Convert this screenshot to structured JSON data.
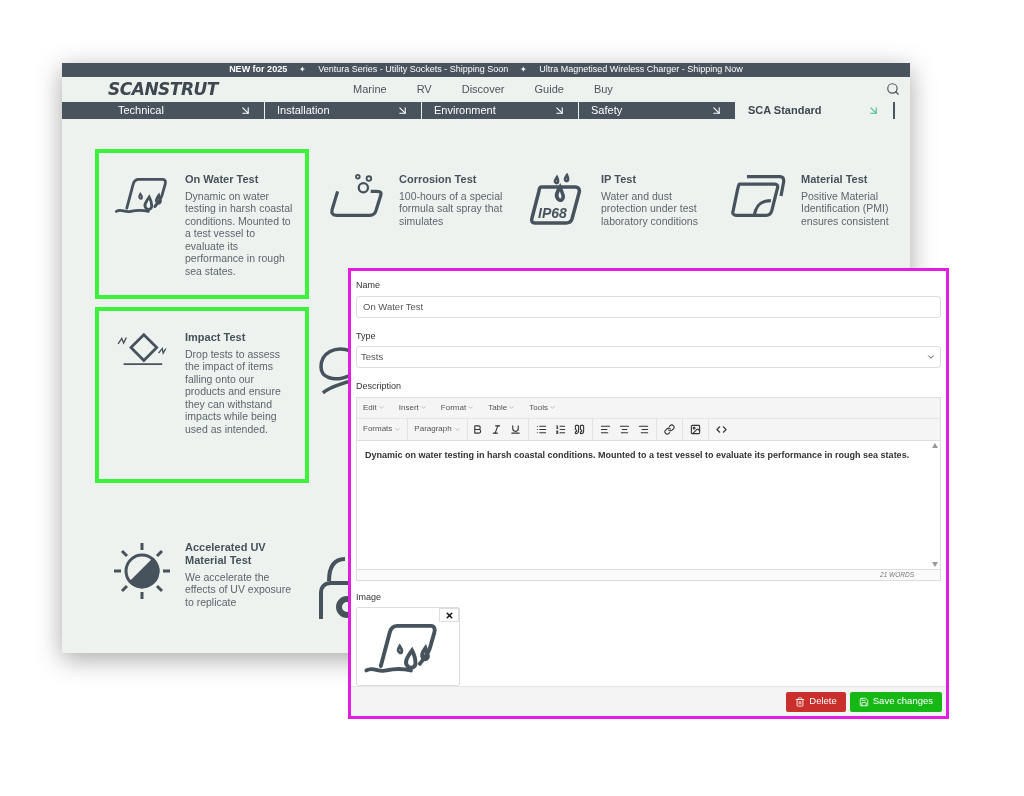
{
  "announcement_bar": [
    {
      "kind": "bold",
      "text": "NEW for 2025"
    },
    {
      "kind": "separator",
      "text": "✦"
    },
    {
      "kind": "plain",
      "text": "Ventura Series - Utility Sockets -  Shipping Soon"
    },
    {
      "kind": "separator",
      "text": "✦"
    },
    {
      "kind": "plain",
      "text": "Ultra Magnetised Wireless Charger  -  Shipping Now"
    }
  ],
  "header": {
    "logo": "SCANSTRUT",
    "nav": [
      "Marine",
      "RV",
      "Discover",
      "Guide",
      "Buy"
    ]
  },
  "tabs": [
    {
      "label": "Technical",
      "selected": false
    },
    {
      "label": "Installation",
      "selected": false
    },
    {
      "label": "Environment",
      "selected": false
    },
    {
      "label": "Safety",
      "selected": false
    },
    {
      "label": "SCA Standard",
      "selected": true
    }
  ],
  "card_rows": [
    [
      {
        "kind": "card",
        "title": "On Water Test",
        "description": "Dynamic on water testing in harsh coastal conditions. Mounted to a test vessel to evaluate its performance in rough sea states.",
        "highlighted": true
      },
      {
        "kind": "card",
        "title": "Corrosion Test",
        "description": "100-hours of a special formula salt spray that simulates",
        "highlighted": false
      },
      {
        "kind": "card",
        "title": "IP Test",
        "description": "Water and dust protection under test laboratory conditions",
        "highlighted": false,
        "badge": "IP68"
      },
      {
        "kind": "card",
        "title": "Material Test",
        "description": "Positive Material Identification (PMI) ensures consistent",
        "highlighted": false
      }
    ],
    [
      {
        "kind": "card",
        "title": "Impact Test",
        "description": "Drop tests to assess the impact of items falling onto our products and ensure they can withstand impacts while being used as intended.",
        "highlighted": true
      },
      {
        "kind": "covered"
      }
    ],
    [
      {
        "kind": "card",
        "title": "Accelerated UV Material Test",
        "description": "We accelerate the effects of UV exposure to replicate",
        "highlighted": false
      },
      {
        "kind": "covered"
      }
    ]
  ],
  "editor": {
    "name_label": "Name",
    "name_value": "On Water Test",
    "type_label": "Type",
    "type_value": "Tests",
    "description_label": "Description",
    "menus": [
      "Edit",
      "Insert",
      "Format",
      "Table",
      "Tools"
    ],
    "dropdowns": [
      "Formats",
      "Paragraph"
    ],
    "body": "Dynamic on water testing in harsh coastal conditions. Mounted to a test vessel to evaluate its performance in rough sea states.",
    "word_count": "21 WORDS",
    "image_label": "Image",
    "buttons": [
      {
        "kind": "delete",
        "label": "Delete"
      },
      {
        "kind": "save",
        "label": "Save changes"
      }
    ]
  }
}
